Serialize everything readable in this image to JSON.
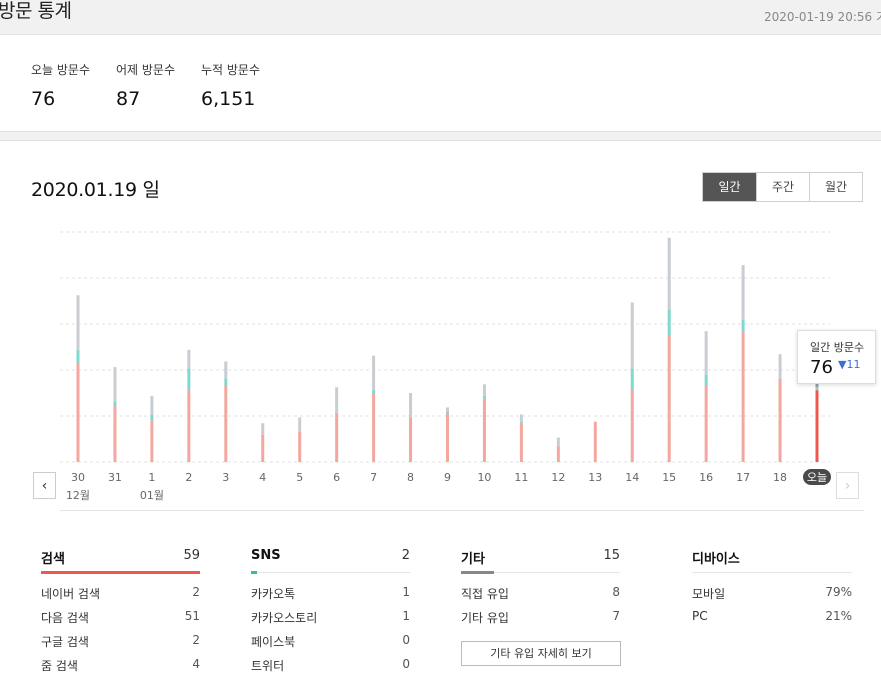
{
  "header": {
    "title": "방문 통계",
    "timestamp": "2020-01-19 20:56 기"
  },
  "summary": {
    "today_label": "오늘 방문수",
    "today_value": "76",
    "yesterday_label": "어제 방문수",
    "yesterday_value": "87",
    "total_label": "누적 방문수",
    "total_value": "6,151"
  },
  "main": {
    "date_title": "2020.01.19 일",
    "tabs": [
      {
        "label": "일간",
        "active": true
      },
      {
        "label": "주간",
        "active": false
      },
      {
        "label": "월간",
        "active": false
      }
    ]
  },
  "tooltip": {
    "label": "일간 방문수",
    "value": "76",
    "delta": "▼11"
  },
  "colors": {
    "search": "#f4a79e",
    "sns": "#7fd8cd",
    "other": "#c9ccd0",
    "today": "#f0584f",
    "search_accent": "#f0584f",
    "sns_accent": "#2cc3a0",
    "other_accent": "#888888"
  },
  "chart_data": {
    "type": "bar",
    "stacked": true,
    "categories": [
      "30",
      "31",
      "1",
      "2",
      "3",
      "4",
      "5",
      "6",
      "7",
      "8",
      "9",
      "10",
      "11",
      "12",
      "13",
      "14",
      "15",
      "16",
      "17",
      "18",
      "오늘"
    ],
    "month_labels": [
      {
        "index": 0,
        "label": "12월"
      },
      {
        "index": 2,
        "label": "01월"
      }
    ],
    "series": [
      {
        "values": [
          69,
          39,
          29,
          50,
          53,
          19,
          21,
          34,
          48,
          31,
          34,
          44,
          27,
          11,
          28,
          50,
          88,
          53,
          91,
          58,
          50
        ]
      },
      {
        "values": [
          9,
          3,
          4,
          15,
          5,
          0,
          0,
          0,
          2,
          0,
          1,
          2,
          1,
          0,
          0,
          15,
          18,
          8,
          8,
          0,
          2
        ]
      },
      {
        "values": [
          38,
          24,
          13,
          13,
          12,
          8,
          10,
          18,
          24,
          17,
          3,
          8,
          5,
          6,
          0,
          46,
          50,
          30,
          38,
          17,
          14
        ]
      }
    ],
    "ylim": [
      0,
      160
    ],
    "grid": true
  },
  "sections": {
    "search": {
      "title": "검색",
      "total": "59",
      "ratio": 1.0,
      "rows": [
        {
          "name": "네이버 검색",
          "value": "2"
        },
        {
          "name": "다음 검색",
          "value": "51"
        },
        {
          "name": "구글 검색",
          "value": "2"
        },
        {
          "name": "줌 검색",
          "value": "4"
        }
      ]
    },
    "sns": {
      "title": "SNS",
      "total": "2",
      "ratio": 0.04,
      "rows": [
        {
          "name": "카카오톡",
          "value": "1"
        },
        {
          "name": "카카오스토리",
          "value": "1"
        },
        {
          "name": "페이스북",
          "value": "0"
        },
        {
          "name": "트위터",
          "value": "0"
        }
      ]
    },
    "other": {
      "title": "기타",
      "total": "15",
      "ratio": 0.21,
      "rows": [
        {
          "name": "직접 유입",
          "value": "8"
        },
        {
          "name": "기타 유입",
          "value": "7"
        }
      ],
      "detail_button": "기타 유입 자세히 보기"
    },
    "device": {
      "title": "디바이스",
      "rows": [
        {
          "name": "모바일",
          "value": "79%"
        },
        {
          "name": "PC",
          "value": "21%"
        }
      ]
    }
  }
}
